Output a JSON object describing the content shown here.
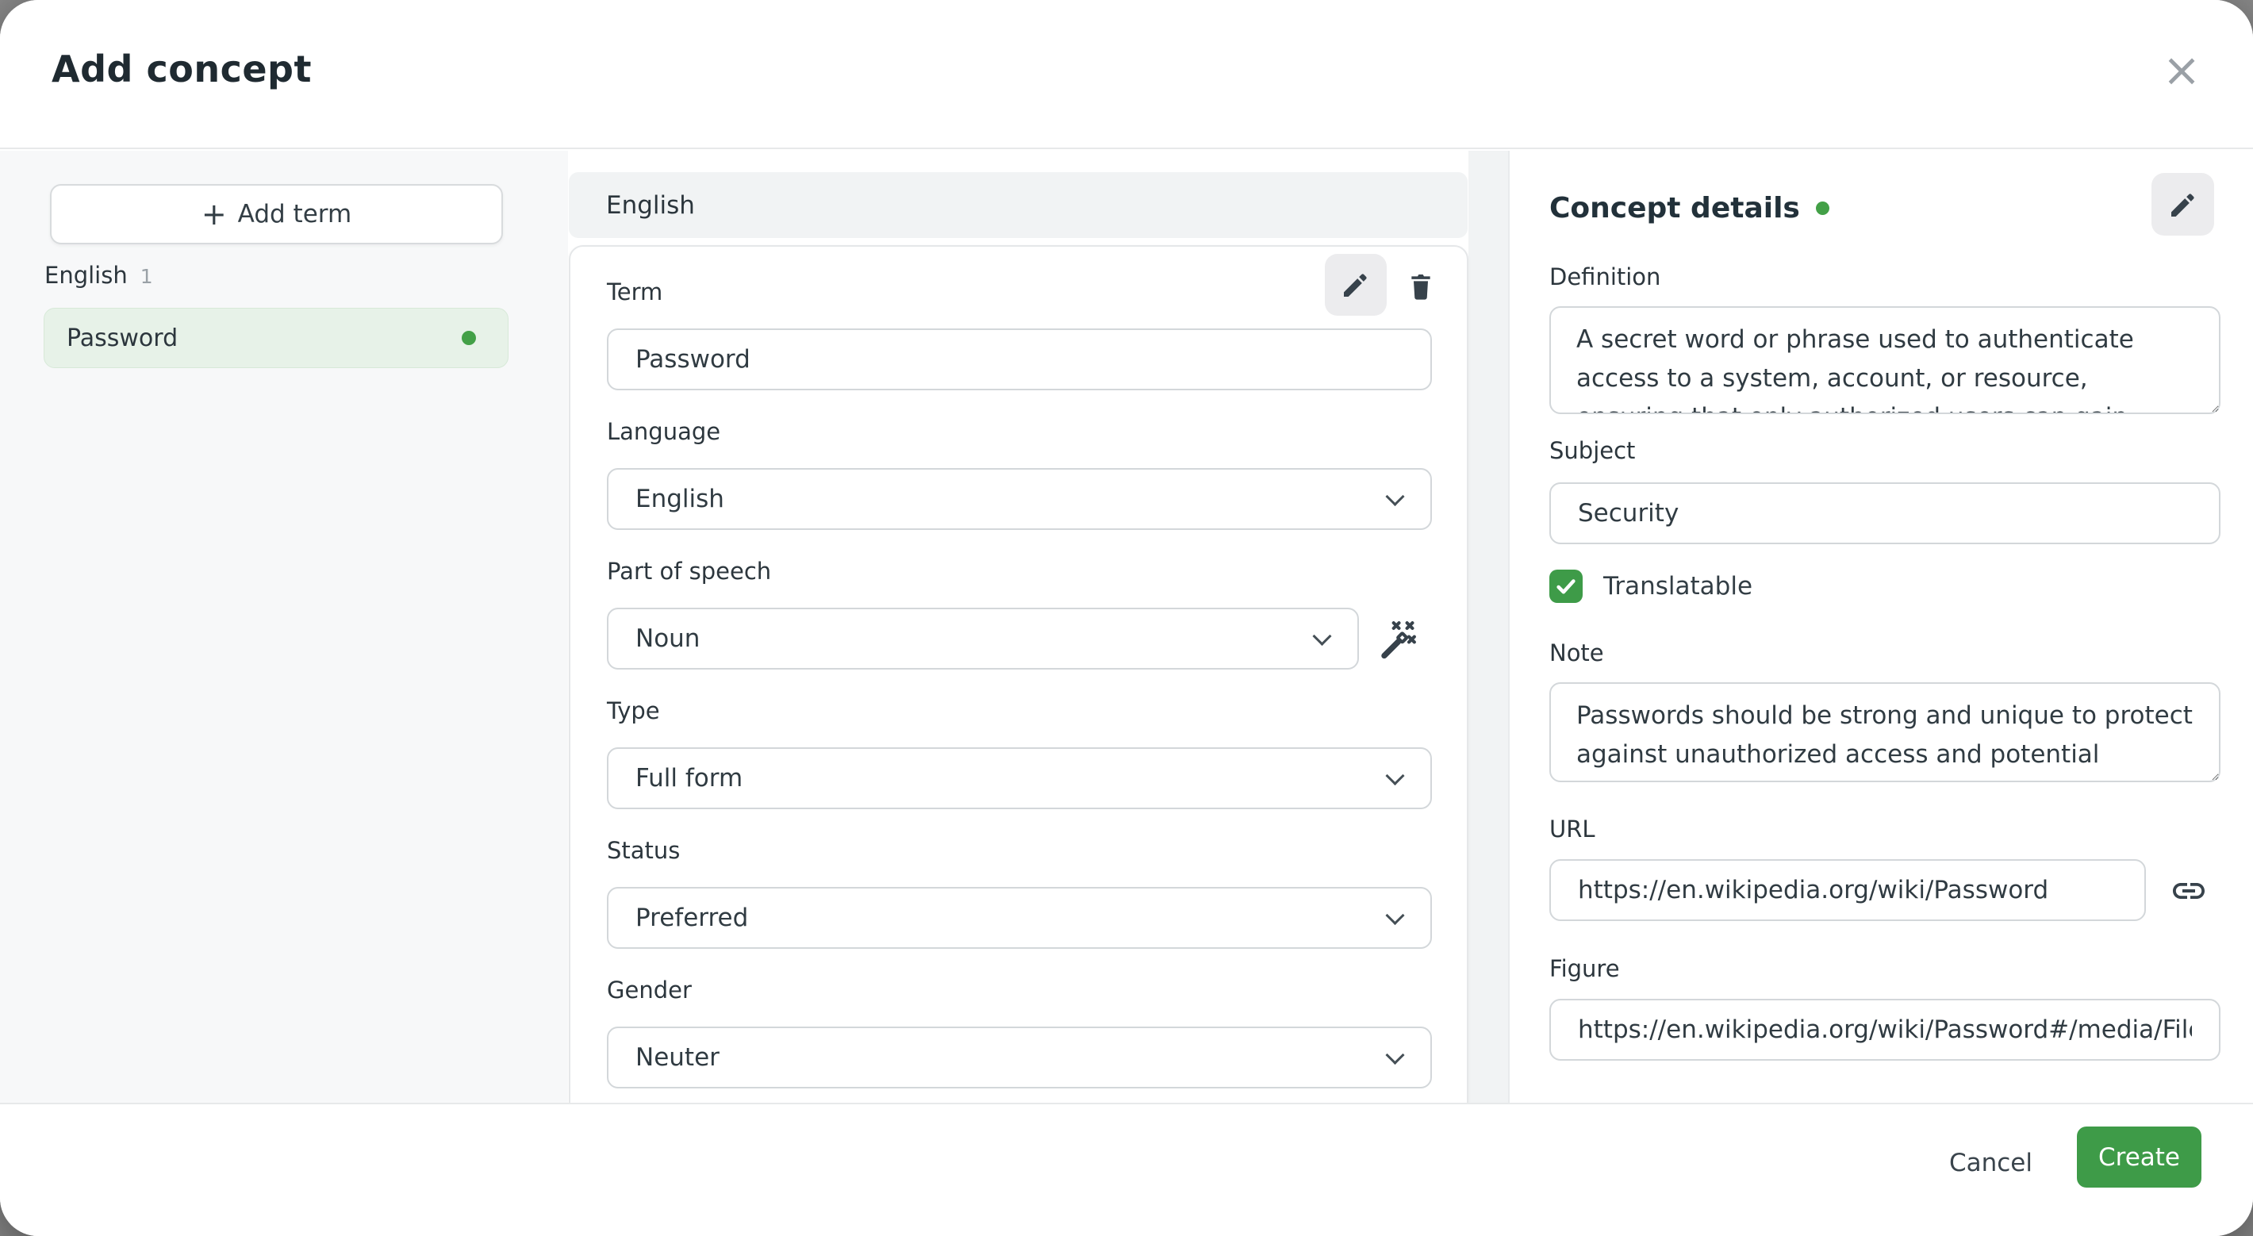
{
  "window": {
    "title": "Add concept"
  },
  "icons": {
    "close": "×",
    "plus": "+"
  },
  "colors": {
    "accent_green": "#3e9b48",
    "status_dot_green": "#43a047",
    "selected_term_bg": "#e7f2e8"
  },
  "sidebar": {
    "add_term": "Add term",
    "group": {
      "label": "English",
      "count": "1"
    },
    "terms": [
      {
        "name": "Password",
        "status": "active"
      }
    ]
  },
  "term_panel": {
    "header": "English",
    "term": {
      "label": "Term",
      "value": "Password"
    },
    "language": {
      "label": "Language",
      "value": "English"
    },
    "part_of_speech": {
      "label": "Part of speech",
      "value": "Noun"
    },
    "type": {
      "label": "Type",
      "value": "Full form"
    },
    "status": {
      "label": "Status",
      "value": "Preferred"
    },
    "gender": {
      "label": "Gender",
      "value": "Neuter"
    }
  },
  "concept": {
    "title": "Concept details",
    "definition": {
      "label": "Definition",
      "value": "A secret word or phrase used to authenticate access to a system, account, or resource, ensuring that only authorized users can gain entry."
    },
    "subject": {
      "label": "Subject",
      "value": "Security"
    },
    "translatable": {
      "label": "Translatable",
      "checked": true
    },
    "note": {
      "label": "Note",
      "value": "Passwords should be strong and unique to protect against unauthorized access and potential breaches."
    },
    "url": {
      "label": "URL",
      "value": "https://en.wikipedia.org/wiki/Password"
    },
    "figure": {
      "label": "Figure",
      "value": "https://en.wikipedia.org/wiki/Password#/media/File"
    }
  },
  "footer": {
    "cancel": "Cancel",
    "create": "Create"
  }
}
